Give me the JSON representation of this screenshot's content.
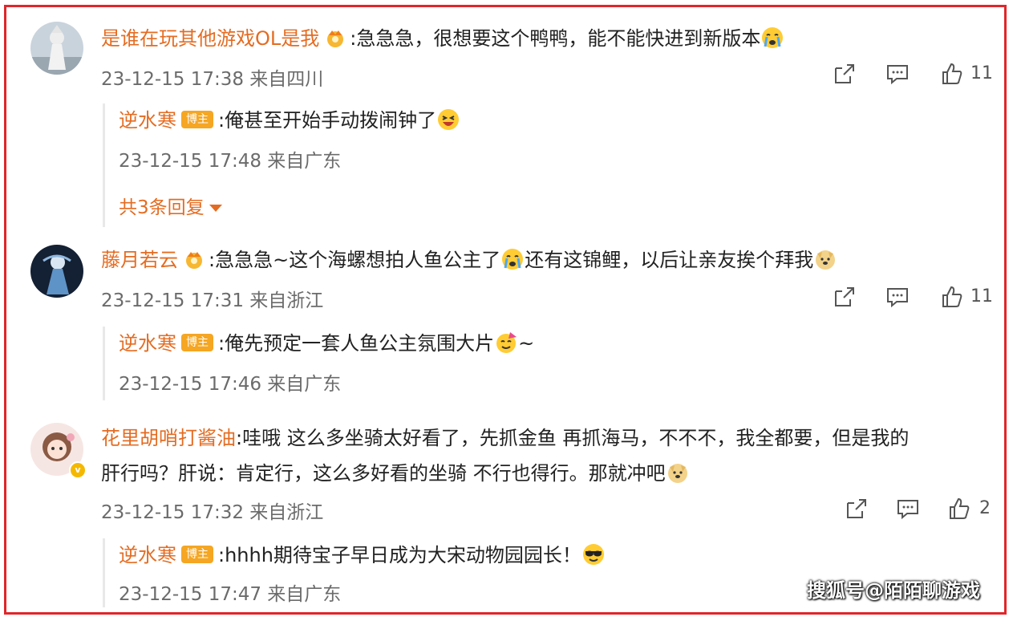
{
  "colors": {
    "frame": "#e0262b",
    "username": "#e46c22",
    "badge": "#f5a623",
    "meta": "#6b6b6b"
  },
  "comments": [
    {
      "username": "是谁在玩其他游戏OL是我",
      "text": ":急急急，很想要这个鸭鸭，能不能快进到新版本",
      "time": "23-12-15 17:38 来自四川",
      "likes": "11",
      "emoji_end": "crying-face",
      "reply": {
        "username": "逆水寒",
        "badge": "博主",
        "text": ":俺甚至开始手动拨闹钟了",
        "emoji_end": "laughing-face",
        "time": "23-12-15 17:48 来自广东",
        "more": "共3条回复"
      }
    },
    {
      "username": "藤月若云",
      "text_a": ":急急急~这个海螺想拍人鱼公主了",
      "text_b": "还有这锦鲤，以后让亲友挨个拜我",
      "time": "23-12-15 17:31 来自浙江",
      "likes": "11",
      "reply": {
        "username": "逆水寒",
        "badge": "博主",
        "text": ":俺先预定一套人鱼公主氛围大片",
        "text_end": "~",
        "time": "23-12-15 17:46 来自广东"
      }
    },
    {
      "username": "花里胡哨打酱油",
      "text_1": ":哇哦 这么多坐骑太好看了，先抓金鱼 再抓海马，不不不，我全都要，但是我的",
      "text_2": "肝行吗？肝说：肯定行，这么多好看的坐骑 不行也得行。那就冲吧",
      "time": "23-12-15 17:32 来自浙江",
      "likes": "2",
      "reply": {
        "username": "逆水寒",
        "badge": "博主",
        "text": ":hhhh期待宝子早日成为大宋动物园园长！",
        "time": "23-12-15 17:47 来自广东"
      }
    }
  ],
  "watermark": "搜狐号@陌陌聊游戏"
}
